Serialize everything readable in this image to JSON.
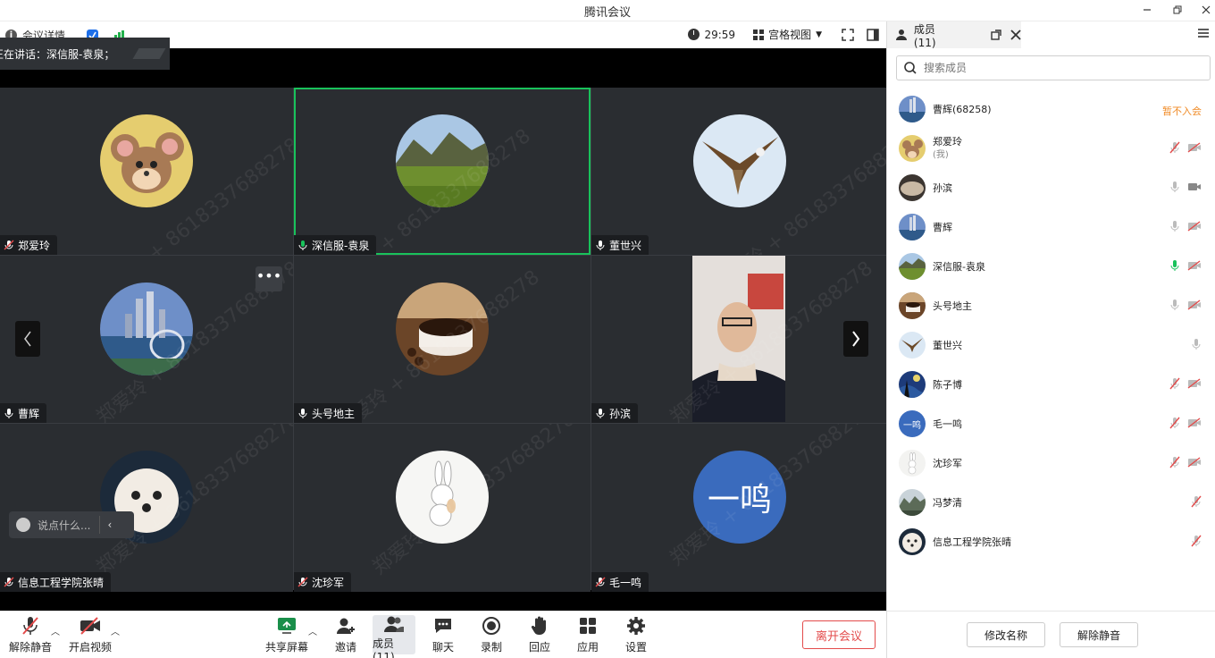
{
  "window": {
    "title": "腾讯会议"
  },
  "topbar": {
    "meeting_info": "会议详情",
    "timer": "29:59",
    "view_mode": "宫格视图"
  },
  "speaking": {
    "text": "正在讲话：深信服-袁泉；"
  },
  "watermark": "郑爱玲 + 8618337688278",
  "tiles": [
    {
      "name": "郑爱玲",
      "mic": "muted",
      "avatar": "jerry-mouse"
    },
    {
      "name": "深信服-袁泉",
      "mic": "active",
      "avatar": "mountain-meadow",
      "active": true
    },
    {
      "name": "董世兴",
      "mic": "on",
      "avatar": "eagle"
    },
    {
      "name": "曹辉",
      "mic": "on",
      "avatar": "city-skyline"
    },
    {
      "name": "头号地主",
      "mic": "on",
      "avatar": "coffee-cup"
    },
    {
      "name": "孙滨",
      "mic": "on",
      "avatar": "man-video"
    },
    {
      "name": "信息工程学院张晴",
      "mic": "muted",
      "avatar": "white-puppy"
    },
    {
      "name": "沈珍军",
      "mic": "muted",
      "avatar": "rabbit"
    },
    {
      "name": "毛一鸣",
      "mic": "muted",
      "avatar": "text",
      "avatar_text": "一鸣"
    }
  ],
  "chat": {
    "placeholder": "说点什么..."
  },
  "toolbar": {
    "unmute": "解除静音",
    "start_video": "开启视频",
    "share_screen": "共享屏幕",
    "invite": "邀请",
    "members": "成员(11)",
    "chat": "聊天",
    "record": "录制",
    "reactions": "回应",
    "apps": "应用",
    "settings": "设置",
    "leave": "离开会议"
  },
  "panel": {
    "tab": "成员(11)",
    "search_placeholder": "搜索成员",
    "members": [
      {
        "name": "曹辉(68258)",
        "status": "暂不入会",
        "avatar": "city-skyline"
      },
      {
        "name": "郑爱玲",
        "sub": "(我)",
        "mic": "muted",
        "cam": "off",
        "avatar": "jerry-mouse"
      },
      {
        "name": "孙滨",
        "mic": "on",
        "cam": "on",
        "avatar": "rock"
      },
      {
        "name": "曹辉",
        "mic": "on",
        "cam": "off",
        "avatar": "city-skyline"
      },
      {
        "name": "深信服-袁泉",
        "mic": "active",
        "cam": "off",
        "avatar": "mountain-meadow"
      },
      {
        "name": "头号地主",
        "mic": "on",
        "cam": "off",
        "avatar": "coffee-cup"
      },
      {
        "name": "董世兴",
        "mic": "on",
        "avatar": "eagle"
      },
      {
        "name": "陈子博",
        "mic": "muted",
        "cam": "off",
        "avatar": "starry-night"
      },
      {
        "name": "毛一鸣",
        "mic": "muted",
        "cam": "off",
        "avatar": "text",
        "avatar_text": "一鸣"
      },
      {
        "name": "沈珍军",
        "mic": "muted",
        "cam": "off",
        "avatar": "rabbit"
      },
      {
        "name": "冯梦清",
        "mic": "muted",
        "avatar": "landscape"
      },
      {
        "name": "信息工程学院张晴",
        "mic": "muted",
        "avatar": "white-puppy"
      }
    ],
    "rename": "修改名称",
    "unmute": "解除静音"
  },
  "colors": {
    "accent_green": "#19c25b",
    "leave_red": "#e34b4b",
    "status_orange": "#f08a24"
  }
}
